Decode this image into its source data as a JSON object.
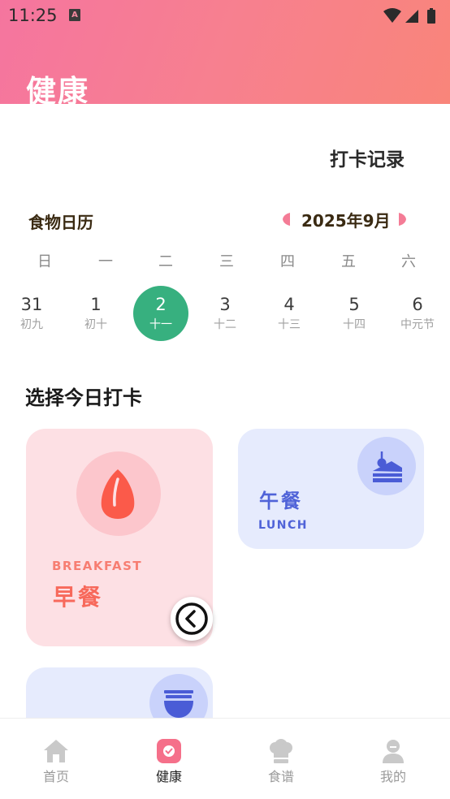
{
  "status_bar": {
    "time": "11:25",
    "badge": "A"
  },
  "header": {
    "title": "健康"
  },
  "actions": {
    "checkin_record": "打卡记录"
  },
  "calendar": {
    "title": "食物日历",
    "month_label": "2025年9月",
    "weekdays": [
      "日",
      "一",
      "二",
      "三",
      "四",
      "五",
      "六"
    ],
    "days": [
      {
        "num": "31",
        "lunar": "初九"
      },
      {
        "num": "1",
        "lunar": "初十"
      },
      {
        "num": "2",
        "lunar": "十一",
        "selected": true
      },
      {
        "num": "3",
        "lunar": "十二"
      },
      {
        "num": "4",
        "lunar": "十三"
      },
      {
        "num": "5",
        "lunar": "十四"
      },
      {
        "num": "6",
        "lunar": "中元节"
      }
    ]
  },
  "checkin": {
    "title": "选择今日打卡",
    "breakfast": {
      "en": "BREAKFAST",
      "cn": "早餐"
    },
    "lunch": {
      "cn": "午餐",
      "en": "LUNCH"
    }
  },
  "tabbar": {
    "items": [
      {
        "label": "首页",
        "icon": "home-icon"
      },
      {
        "label": "健康",
        "icon": "health-check-icon",
        "active": true
      },
      {
        "label": "食谱",
        "icon": "chef-hat-icon"
      },
      {
        "label": "我的",
        "icon": "profile-icon"
      }
    ]
  },
  "colors": {
    "header_gradient": [
      "#f5759f",
      "#f9857a"
    ],
    "selected_day": "#37b07f",
    "breakfast_bg": "#fde0e4",
    "lunch_bg": "#e6ebfd",
    "lunch_accent": "#5063d8",
    "breakfast_accent": "#f7695b"
  }
}
